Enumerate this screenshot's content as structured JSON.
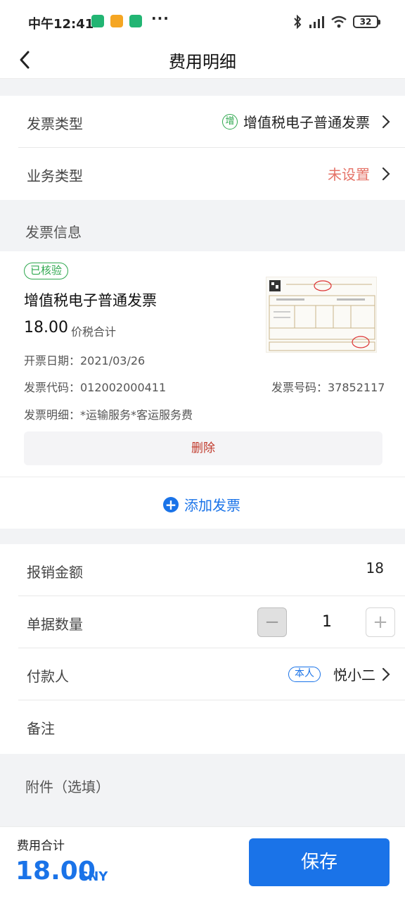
{
  "status_bar": {
    "time": "中午12:41",
    "more": "···",
    "battery": "32",
    "icons": [
      "bluetooth-icon",
      "signal-icon",
      "wifi-icon",
      "battery-icon"
    ]
  },
  "nav": {
    "title": "费用明细"
  },
  "invoice_type": {
    "label": "发票类型",
    "tag": "增",
    "value": "增值税电子普通发票"
  },
  "business_type": {
    "label": "业务类型",
    "value": "未设置"
  },
  "invoice_section": {
    "label": "发票信息"
  },
  "invoice": {
    "badge": "已核验",
    "title": "增值税电子普通发票",
    "amount": "18.00",
    "amount_label": "价税合计",
    "date": "开票日期：2021/03/26",
    "code": "发票代码：012002000411",
    "number": "发票号码：37852117",
    "detail": "发票明细：*运输服务*客运服务费",
    "delete": "删除"
  },
  "add_invoice": {
    "label": "添加发票"
  },
  "reimburse": {
    "label": "报销金额",
    "value": "18"
  },
  "doc_count": {
    "label": "单据数量",
    "value": "1",
    "minus": "−",
    "plus": "+"
  },
  "payer": {
    "label": "付款人",
    "tag": "本人",
    "value": "悦小二"
  },
  "remark": {
    "label": "备注"
  },
  "attachment": {
    "label": "附件（选填）"
  },
  "footer": {
    "total_label": "费用合计",
    "total": "18.00",
    "currency": "CNY",
    "save": "保存"
  },
  "colors": {
    "accent": "#1a73e8",
    "verified": "#2fa84f",
    "warning": "#e57368",
    "danger": "#c0392b"
  }
}
